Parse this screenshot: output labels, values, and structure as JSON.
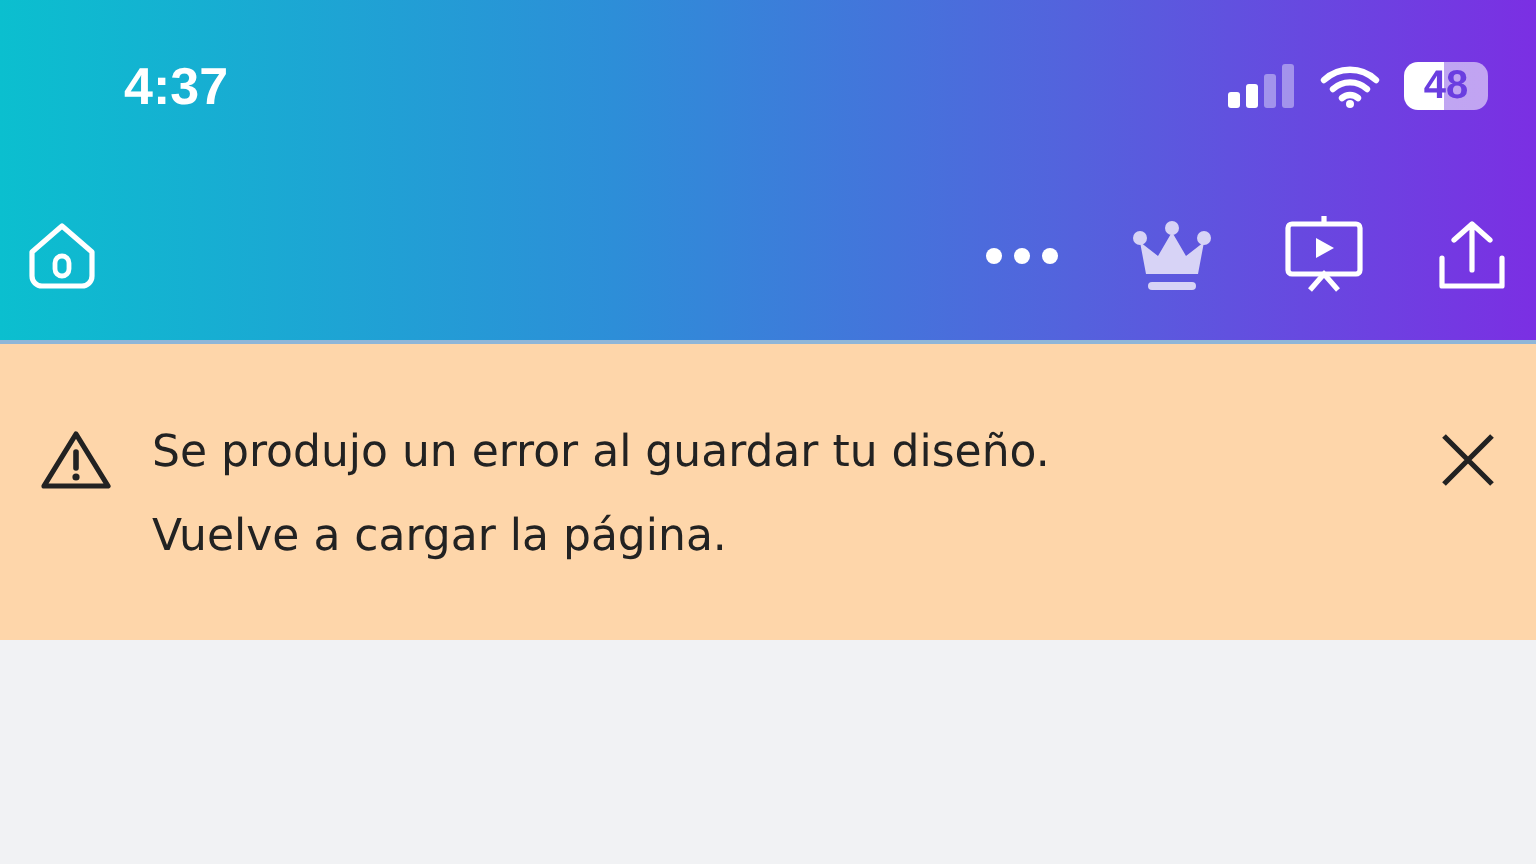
{
  "status_bar": {
    "time": "4:37",
    "battery": "48"
  },
  "banner": {
    "lines": [
      "Se produjo un error al guardar tu diseño.",
      "Vuelve a cargar la página."
    ]
  }
}
